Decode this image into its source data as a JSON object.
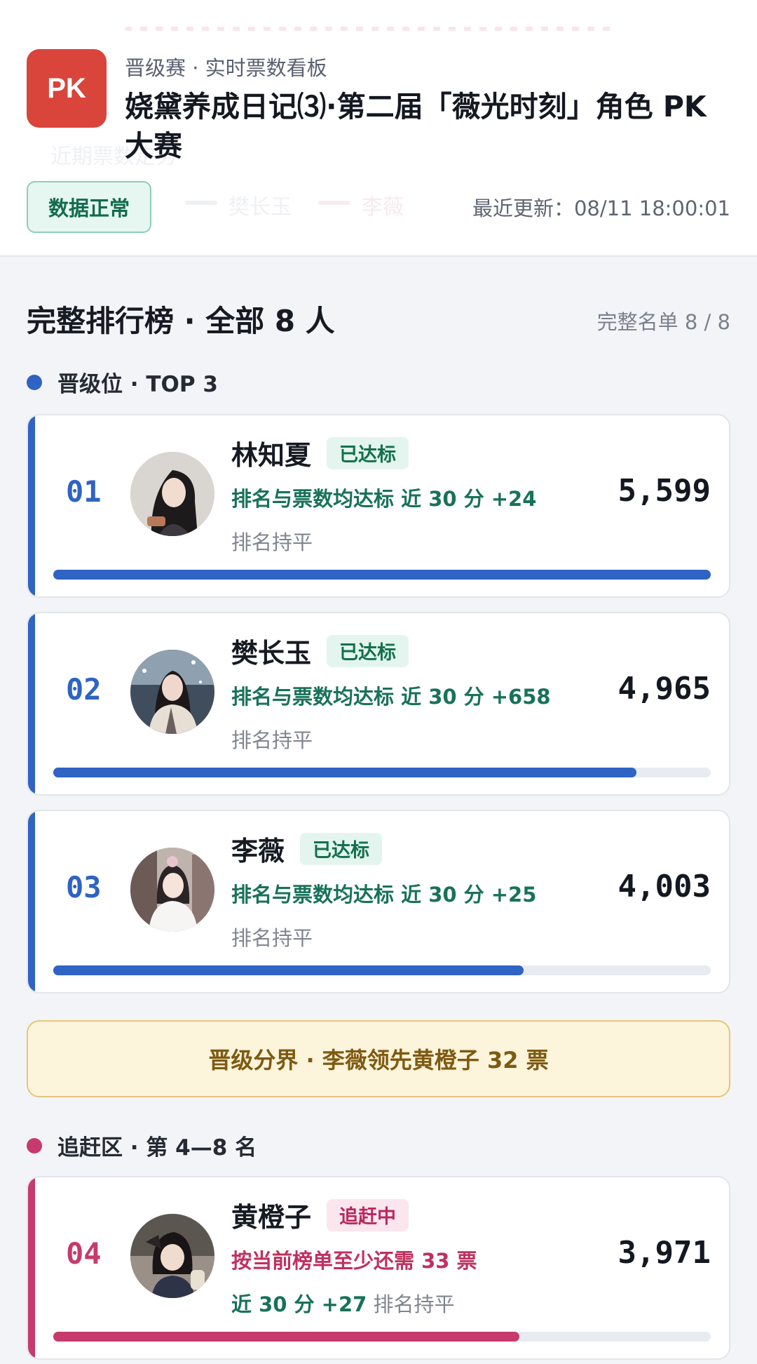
{
  "theme": {
    "qualify": "#2f63c4",
    "chase": "#c63b6b",
    "logo": "#d9453a"
  },
  "header": {
    "logo_text": "PK",
    "subtitle": "晋级赛 · 实时票数看板",
    "title": "娆黛养成日记⑶·第二届「薇光时刻」角色 PK 大赛",
    "status": "数据正常",
    "updated": "最近更新：08/11 18:00:01",
    "ghost_trend_label": "近期票数走势",
    "ghost_legend": [
      "樊长玉",
      "李薇"
    ]
  },
  "board": {
    "title": "完整排行榜 · 全部 8 人",
    "count": "完整名单 8 / 8",
    "qualify_head": "晋级位 · TOP 3",
    "chase_head": "追赶区 · 第 4—8 名",
    "divider": "晋级分界 · 李薇领先黄橙子 32 票"
  },
  "entries": [
    {
      "rank": "01",
      "name": "林知夏",
      "tag": "已达标",
      "line2": "排名与票数均达标  近 30 分 +24",
      "line3": "排名持平",
      "votes": "5,599",
      "progress": 1.0
    },
    {
      "rank": "02",
      "name": "樊长玉",
      "tag": "已达标",
      "line2": "排名与票数均达标  近 30 分 +658",
      "line3": "排名持平",
      "votes": "4,965",
      "progress": 0.887
    },
    {
      "rank": "03",
      "name": "李薇",
      "tag": "已达标",
      "line2": "排名与票数均达标  近 30 分 +25",
      "line3": "排名持平",
      "votes": "4,003",
      "progress": 0.715
    },
    {
      "rank": "04",
      "name": "黄橙子",
      "tag": "追赶中",
      "line2": "按当前榜单至少还需 33 票",
      "line3_delta": "近 30 分 +27",
      "line3": "排名持平",
      "votes": "3,971",
      "progress": 0.709
    }
  ]
}
